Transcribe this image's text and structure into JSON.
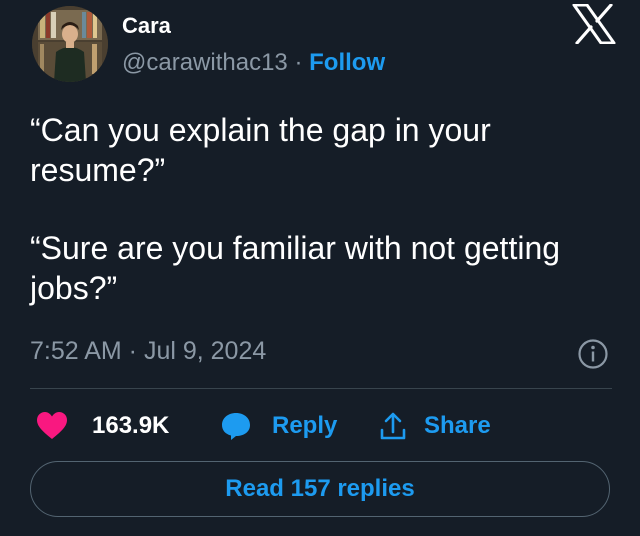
{
  "author": {
    "name": "Cara",
    "handle": "@carawithac13",
    "separator": "·",
    "follow_label": "Follow"
  },
  "platform_logo": "x-logo-icon",
  "tweet": {
    "paragraphs": [
      "“Can you explain the gap in your resume?”",
      "“Sure are you familiar with not getting jobs?”"
    ],
    "timestamp": "7:52 AM · Jul 9, 2024"
  },
  "actions": {
    "likes_count": "163.9K",
    "reply_label": "Reply",
    "share_label": "Share"
  },
  "read_replies_label": "Read 157 replies",
  "colors": {
    "background": "#151d27",
    "accent": "#1d9bf0",
    "like": "#f91880",
    "muted": "#8b98a5"
  }
}
